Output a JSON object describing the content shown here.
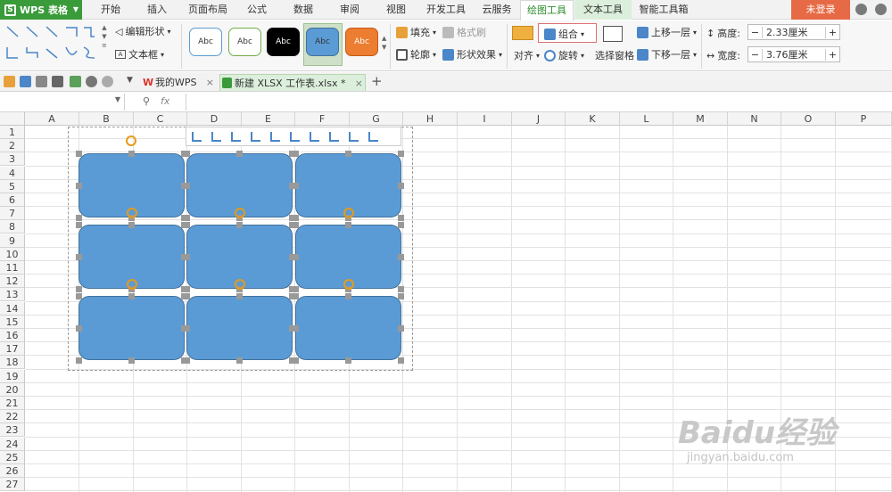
{
  "app": {
    "name": "WPS 表格",
    "login": "未登录"
  },
  "menu_tabs": [
    "开始",
    "插入",
    "页面布局",
    "公式",
    "数据",
    "审阅",
    "视图",
    "开发工具",
    "云服务",
    "绘图工具",
    "文本工具",
    "智能工具箱"
  ],
  "ribbon": {
    "edit_shape": "编辑形状",
    "text_box": "文本框",
    "style_label": "Abc",
    "fill": "填充",
    "format_brush": "格式刷",
    "outline": "轮廓",
    "shape_effect": "形状效果",
    "group": "组合",
    "align": "对齐",
    "rotate": "旋转",
    "selection_pane": "选择窗格",
    "bring_forward": "上移一层",
    "send_backward": "下移一层",
    "height_label": "高度:",
    "height_value": "2.33厘米",
    "width_label": "宽度:",
    "width_value": "3.76厘米"
  },
  "doc_tabs": [
    {
      "label": "我的WPS"
    },
    {
      "label": "新建 XLSX 工作表.xlsx *"
    }
  ],
  "formula_bar": {
    "fx": "fx"
  },
  "columns": [
    "A",
    "B",
    "C",
    "D",
    "E",
    "F",
    "G",
    "H",
    "I",
    "J",
    "K",
    "L",
    "M",
    "N",
    "O",
    "P"
  ],
  "rows": [
    "1",
    "2",
    "3",
    "4",
    "5",
    "6",
    "7",
    "8",
    "9",
    "10",
    "11",
    "12",
    "13",
    "14",
    "15",
    "16",
    "17",
    "18",
    "19",
    "20",
    "21",
    "22",
    "23",
    "24",
    "25",
    "26",
    "27"
  ],
  "watermark": {
    "brand": "Baidu经验",
    "url": "jingyan.baidu.com"
  },
  "colors": {
    "brand_green": "#3a9b3a",
    "shape_fill": "#5b9bd5",
    "login_orange": "#e66a45"
  }
}
